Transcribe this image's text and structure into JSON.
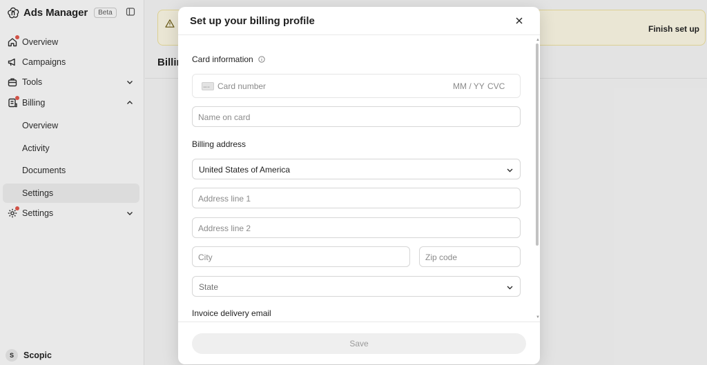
{
  "app": {
    "title": "Ads Manager",
    "badge": "Beta"
  },
  "sidebar": {
    "items": [
      {
        "label": "Overview",
        "icon": "home-icon",
        "has_alert_dot": true
      },
      {
        "label": "Campaigns",
        "icon": "megaphone-icon"
      },
      {
        "label": "Tools",
        "icon": "toolbox-icon",
        "expanded": false
      },
      {
        "label": "Billing",
        "icon": "billing-icon",
        "expanded": true,
        "has_alert_dot": true
      },
      {
        "label": "Overview",
        "sub": true
      },
      {
        "label": "Activity",
        "sub": true
      },
      {
        "label": "Documents",
        "sub": true
      },
      {
        "label": "Settings",
        "sub": true,
        "active": true
      },
      {
        "label": "Settings",
        "icon": "gear-icon",
        "expanded": false,
        "has_alert_dot": true
      }
    ],
    "user": {
      "initial": "S",
      "name": "Scopic"
    }
  },
  "main": {
    "banner_action": "Finish set up",
    "page_title_partial": "Billin"
  },
  "modal": {
    "title": "Set up your billing profile",
    "card_section_label": "Card information",
    "card_number_placeholder": "Card number",
    "expiry_placeholder": "MM / YY",
    "cvc_placeholder": "CVC",
    "name_on_card_placeholder": "Name on card",
    "billing_address_label": "Billing address",
    "country_value": "United States of America",
    "address1_placeholder": "Address line 1",
    "address2_placeholder": "Address line 2",
    "city_placeholder": "City",
    "zip_placeholder": "Zip code",
    "state_placeholder": "State",
    "invoice_email_label": "Invoice delivery email",
    "save_label": "Save"
  },
  "colors": {
    "banner_bg": "#fbf7e3",
    "alert_dot": "#e0564a",
    "active_nav_bg": "#ececec",
    "save_disabled_bg": "#efefef"
  }
}
